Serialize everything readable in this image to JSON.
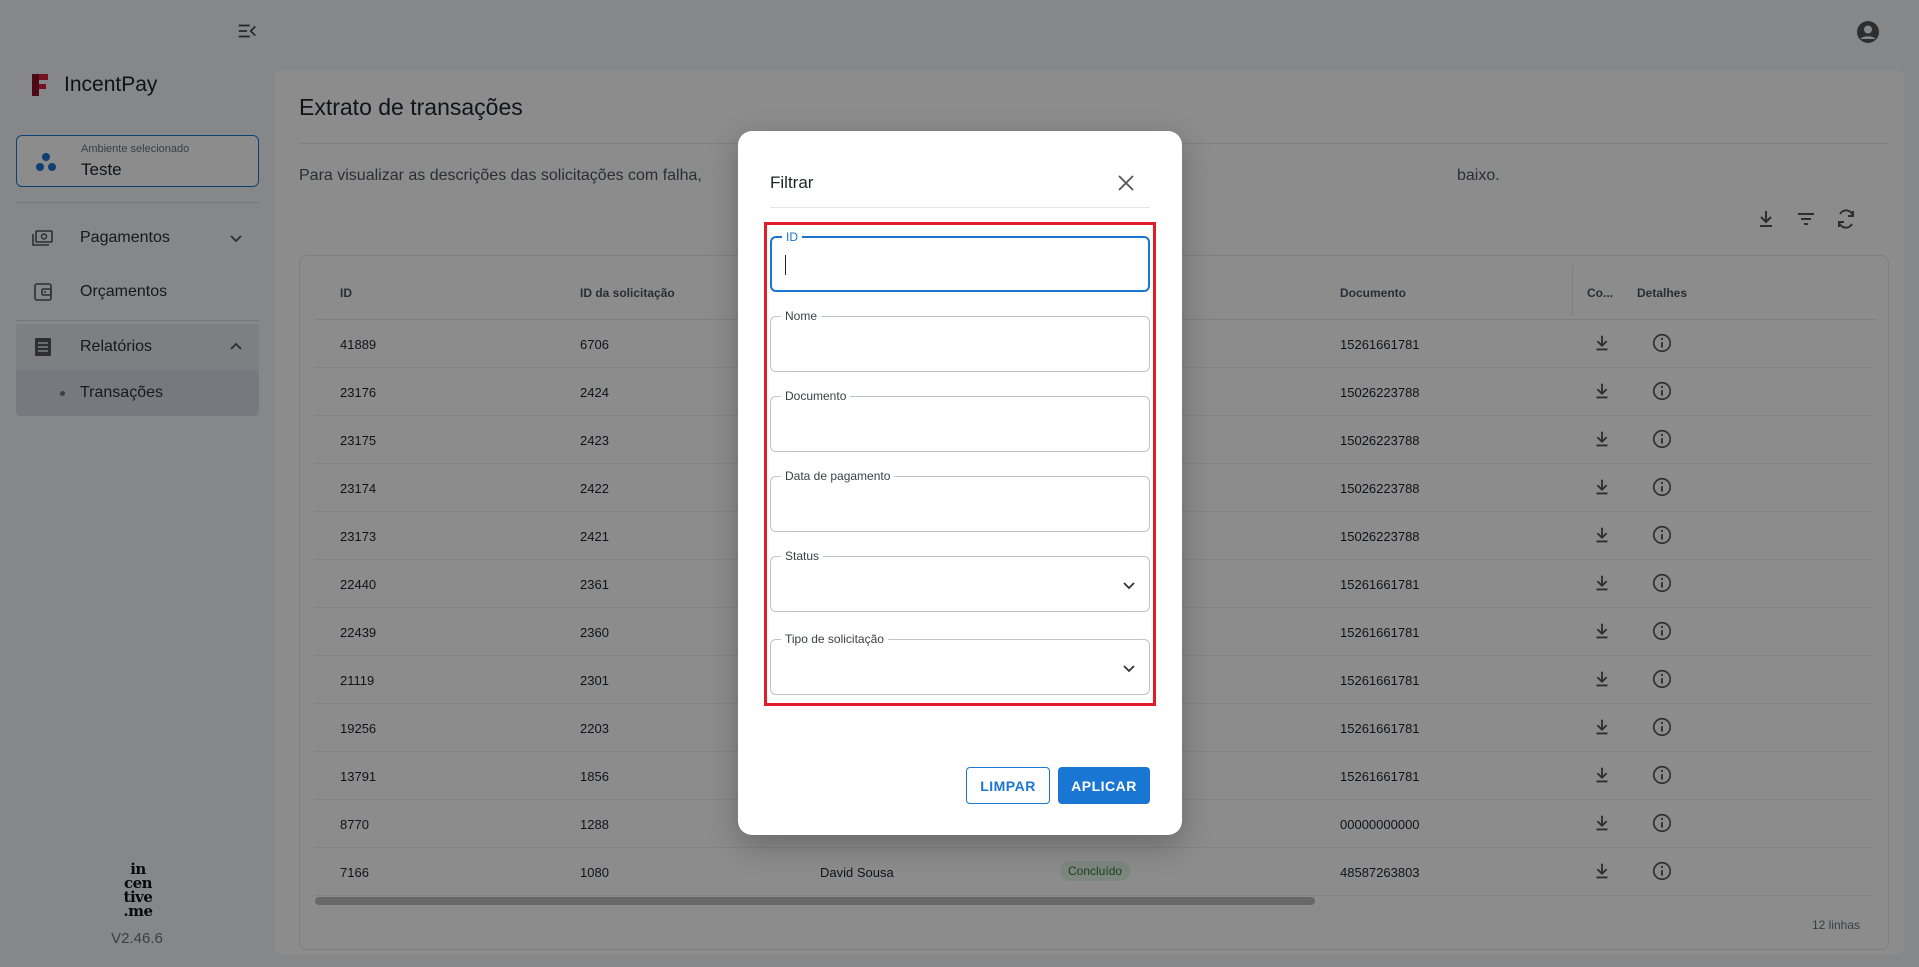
{
  "app": {
    "name": "IncentPay",
    "version": "V2.46.6",
    "footer_brand": [
      "in",
      "cen",
      "tive",
      ".me"
    ]
  },
  "sidebar": {
    "environment": {
      "caption": "Ambiente selecionado",
      "value": "Teste"
    },
    "items": [
      {
        "label": "Pagamentos",
        "icon": "payments-icon",
        "expanded": false
      },
      {
        "label": "Orçamentos",
        "icon": "wallet-icon"
      },
      {
        "label": "Relatórios",
        "icon": "report-icon",
        "expanded": true
      },
      {
        "label": "Transações",
        "sub": true,
        "selected": true
      }
    ]
  },
  "page": {
    "title": "Extrato de transações",
    "info_start": "Para visualizar as descrições das solicitações com falha,",
    "info_end": "baixo."
  },
  "table": {
    "columns": [
      "ID",
      "ID da solicitação",
      "Documento",
      "Co...",
      "Detalhes"
    ],
    "rows": [
      {
        "id": "41889",
        "request_id": "6706",
        "name": "",
        "status": "",
        "document": "15261661781"
      },
      {
        "id": "23176",
        "request_id": "2424",
        "name": "",
        "status": "",
        "document": "15026223788"
      },
      {
        "id": "23175",
        "request_id": "2423",
        "name": "",
        "status": "",
        "document": "15026223788"
      },
      {
        "id": "23174",
        "request_id": "2422",
        "name": "",
        "status": "",
        "document": "15026223788"
      },
      {
        "id": "23173",
        "request_id": "2421",
        "name": "",
        "status": "",
        "document": "15026223788"
      },
      {
        "id": "22440",
        "request_id": "2361",
        "name": "",
        "status": "",
        "document": "15261661781"
      },
      {
        "id": "22439",
        "request_id": "2360",
        "name": "",
        "status": "",
        "document": "15261661781"
      },
      {
        "id": "21119",
        "request_id": "2301",
        "name": "",
        "status": "",
        "document": "15261661781"
      },
      {
        "id": "19256",
        "request_id": "2203",
        "name": "",
        "status": "",
        "document": "15261661781"
      },
      {
        "id": "13791",
        "request_id": "1856",
        "name": "",
        "status": "",
        "document": "15261661781"
      },
      {
        "id": "8770",
        "request_id": "1288",
        "name": "",
        "status": "",
        "document": "00000000000"
      },
      {
        "id": "7166",
        "request_id": "1080",
        "name": "David Sousa",
        "status": "Concluído",
        "document": "48587263803"
      }
    ],
    "row_count": "12 linhas"
  },
  "modal": {
    "title": "Filtrar",
    "fields": [
      {
        "label": "ID",
        "value": "",
        "type": "text",
        "focused": true
      },
      {
        "label": "Nome",
        "value": "",
        "type": "text"
      },
      {
        "label": "Documento",
        "value": "",
        "type": "text"
      },
      {
        "label": "Data de pagamento",
        "value": "",
        "type": "text"
      },
      {
        "label": "Status",
        "value": "",
        "type": "select"
      },
      {
        "label": "Tipo de solicitação",
        "value": "",
        "type": "select"
      }
    ],
    "clear_label": "LIMPAR",
    "apply_label": "APLICAR"
  },
  "colors": {
    "primary": "#1976d2",
    "highlight": "#e11d2a",
    "success_bg": "#e6f4ea",
    "success_text": "#2e7d32"
  }
}
